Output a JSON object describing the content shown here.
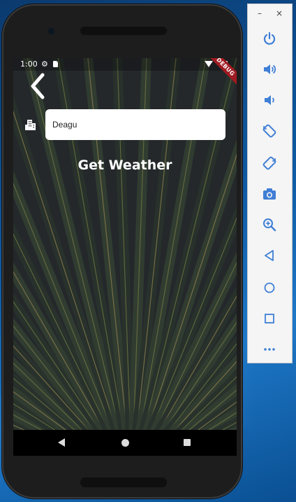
{
  "status_bar": {
    "time": "1:00"
  },
  "debug_banner": "DEBUG",
  "city_field": {
    "value": "Deagu"
  },
  "action": {
    "get_weather_label": "Get Weather"
  },
  "emulator": {
    "window_controls": {
      "minimize": "–",
      "close": "×"
    },
    "tools": [
      {
        "icon": "power-icon"
      },
      {
        "icon": "volume-up-icon"
      },
      {
        "icon": "volume-down-icon"
      },
      {
        "icon": "rotate-left-icon"
      },
      {
        "icon": "rotate-right-icon"
      },
      {
        "icon": "camera-icon"
      },
      {
        "icon": "zoom-icon"
      },
      {
        "icon": "back-triangle-icon"
      },
      {
        "icon": "home-circle-icon"
      },
      {
        "icon": "overview-square-icon"
      },
      {
        "icon": "more-icon"
      }
    ]
  },
  "colors": {
    "accent_blue": "#3f7fd6",
    "debug_red": "#a01b22",
    "text_white": "#ffffff"
  }
}
